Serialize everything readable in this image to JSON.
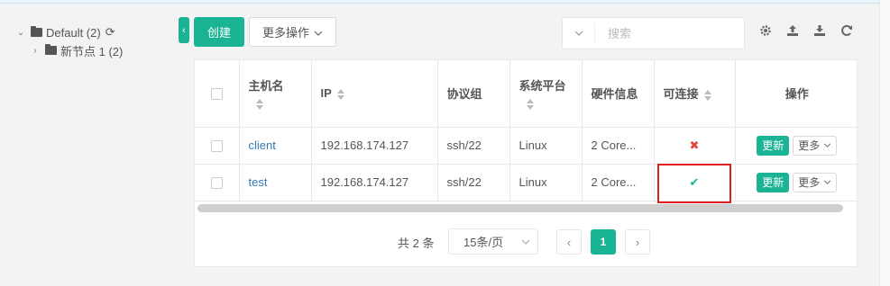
{
  "tree": {
    "root_label": "Default (2)",
    "child_label": "新节点 1 (2)"
  },
  "toolbar": {
    "create_label": "创建",
    "more_actions_label": "更多操作"
  },
  "search": {
    "placeholder": "搜索"
  },
  "table": {
    "columns": [
      "主机名",
      "IP",
      "协议组",
      "系统平台",
      "硬件信息",
      "可连接",
      "操作"
    ],
    "rows": [
      {
        "hostname": "client",
        "ip": "192.168.174.127",
        "protocols": "ssh/22",
        "platform": "Linux",
        "hardware": "2 Core...",
        "connectable": "✖",
        "update_label": "更新",
        "more_label": "更多"
      },
      {
        "hostname": "test",
        "ip": "192.168.174.127",
        "protocols": "ssh/22",
        "platform": "Linux",
        "hardware": "2 Core...",
        "connectable": "✔",
        "update_label": "更新",
        "more_label": "更多"
      }
    ]
  },
  "pagination": {
    "total_label": "共 2 条",
    "page_size_label": "15条/页",
    "current_page": "1",
    "prev_label": "‹",
    "next_label": "›"
  },
  "colors": {
    "accent": "#1ab394",
    "danger": "#e0453d",
    "highlight": "#e02020"
  }
}
